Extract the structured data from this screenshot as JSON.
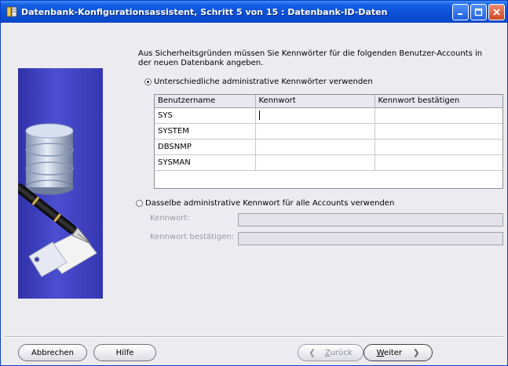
{
  "window": {
    "title": "Datenbank-Konfigurationsassistent, Schritt 5 von 15 : Datenbank-ID-Daten"
  },
  "description": "Aus Sicherheitsgründen müssen Sie Kennwörter für die folgenden Benutzer-Accounts in der neuen Datenbank angeben.",
  "option_different": {
    "label": "Unterschiedliche administrative Kennwörter verwenden",
    "checked": true
  },
  "accounts_table": {
    "columns": [
      "Benutzername",
      "Kennwort",
      "Kennwort bestätigen"
    ],
    "rows": [
      {
        "username": "SYS",
        "password": "",
        "confirm": ""
      },
      {
        "username": "SYSTEM",
        "password": "",
        "confirm": ""
      },
      {
        "username": "DBSNMP",
        "password": "",
        "confirm": ""
      },
      {
        "username": "SYSMAN",
        "password": "",
        "confirm": ""
      }
    ]
  },
  "option_same": {
    "label": "Dasselbe administrative Kennwort für alle Accounts verwenden",
    "checked": false
  },
  "same_password": {
    "password_label": "Kennwort:",
    "confirm_label": "Kennwort bestätigen:"
  },
  "buttons": {
    "cancel": "Abbrechen",
    "help": "Hilfe",
    "back_prefix": "Z",
    "back_rest": "urück",
    "next_prefix": "W",
    "next_rest": "eiter"
  },
  "icons": {
    "title": "app-window-icon",
    "minimize": "minimize-icon",
    "maximize": "maximize-icon",
    "close": "close-icon",
    "back": "chevron-left-icon",
    "next": "chevron-right-icon"
  },
  "colors": {
    "titlebar": "#0b50d8",
    "side_panel": "#3a3cb8",
    "close_button": "#cf4a22"
  }
}
